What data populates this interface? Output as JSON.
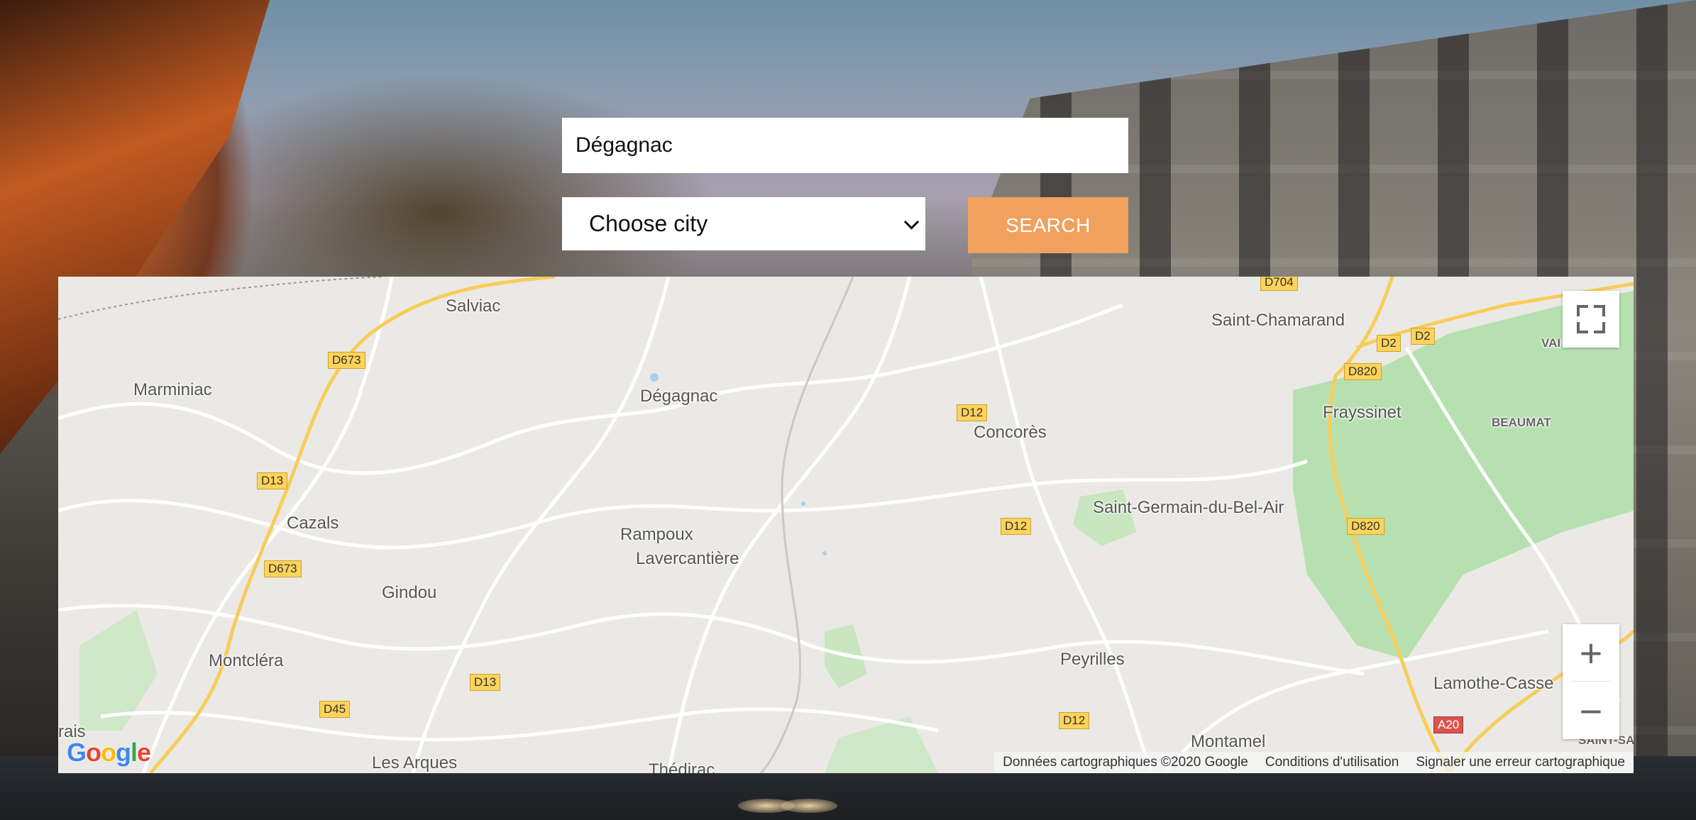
{
  "search": {
    "value": "Dégagnac",
    "city_select_value": "Choose city",
    "button_label": "SEARCH"
  },
  "map": {
    "places": [
      "Salviac",
      "Marminiac",
      "Dégagnac",
      "Concorès",
      "Saint-Chamarand",
      "Frayssinet",
      "BEAUMAT",
      "VAI",
      "Cazals",
      "Rampoux",
      "Lavercantière",
      "Saint-Germain-du-Bel-Air",
      "Gindou",
      "Montcléra",
      "Peyrilles",
      "Lamothe-Casse",
      "Montamel",
      "Les Arques",
      "Thédirac",
      "SAINT-SA",
      "rais"
    ],
    "road_labels": [
      "D704",
      "D673",
      "D2",
      "D2",
      "D820",
      "D12",
      "D13",
      "D820",
      "D12",
      "D673",
      "D13",
      "D45",
      "D12",
      "A20"
    ],
    "logo_text": "Google",
    "attribution": {
      "data": "Données cartographiques ©2020 Google",
      "terms": "Conditions d'utilisation",
      "report": "Signaler une erreur cartographique"
    },
    "controls": {
      "zoom_in": "+",
      "zoom_out": "−"
    }
  }
}
